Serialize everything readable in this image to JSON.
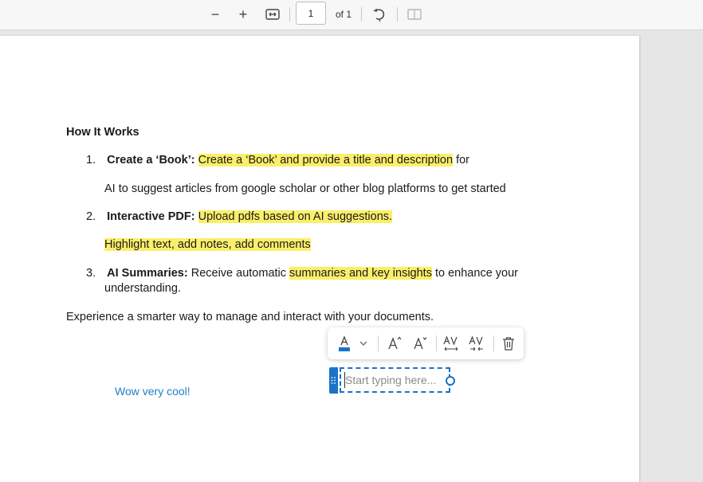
{
  "toolbar": {
    "zoom_out": "−",
    "zoom_in": "+",
    "page_number": "1",
    "page_of": "of 1"
  },
  "doc": {
    "heading": "How It Works",
    "items": [
      {
        "num": "1.",
        "title": "Create a ‘Book’:",
        "highlight": "Create a ‘Book’ and provide a title and description",
        "rest": " for",
        "line2": "AI to suggest articles from google scholar or other blog platforms to get started"
      },
      {
        "num": "2.",
        "title": "Interactive PDF:",
        "highlight": "Upload pdfs based on AI suggestions.",
        "line2_highlight": "Highlight text, add notes, add comments"
      },
      {
        "num": "3.",
        "title": "AI Summaries:",
        "pre": " Receive automatic ",
        "highlight": "summaries and key insights",
        "rest": " to enhance your",
        "line2": "understanding."
      }
    ],
    "closing": "Experience a smarter way to manage and interact with your documents."
  },
  "format_toolbar": {
    "font_color": "#1a73c8"
  },
  "textbox": {
    "placeholder": "Start typing here..."
  },
  "note_text": "Wow very cool!",
  "colors": {
    "highlight": "#fbef6a",
    "accent": "#1a73c8",
    "note": "#1a7fc8"
  }
}
